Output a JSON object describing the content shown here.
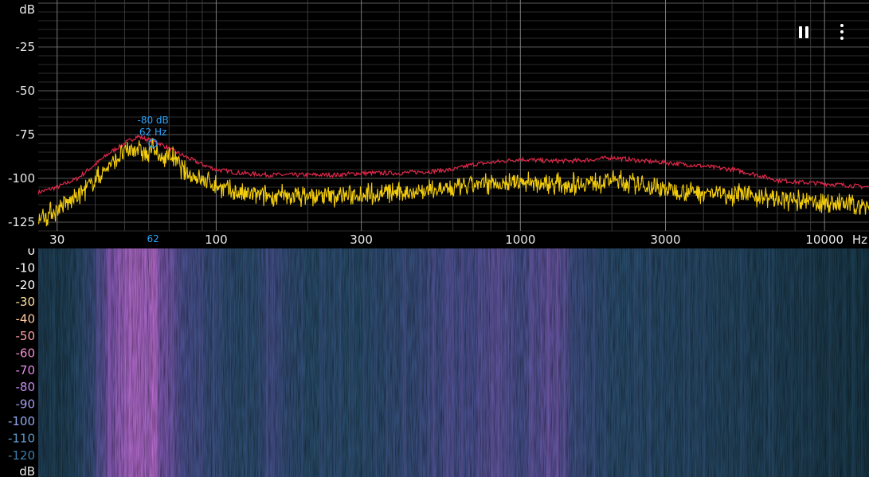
{
  "toolbar": {
    "pause_icon": "pause-icon",
    "menu_icon": "more-vert-icon"
  },
  "chart_data": [
    {
      "type": "line",
      "title": "",
      "xlabel": "Hz",
      "ylabel": "dB",
      "xscale": "log",
      "xlim": [
        26,
        14000
      ],
      "ylim": [
        -130,
        0
      ],
      "grid": true,
      "x_ticks": [
        30,
        100,
        300,
        1000,
        3000,
        10000
      ],
      "x_tick_labels": [
        "30",
        "100",
        "300",
        "1000",
        "3000",
        "10000"
      ],
      "y_ticks": [
        -25,
        -50,
        -75,
        -100,
        -125
      ],
      "y_tick_labels": [
        "-25",
        "-50",
        "-75",
        "-100",
        "-125"
      ],
      "series": [
        {
          "color": "#e0284a",
          "x": [
            26,
            30,
            35,
            40,
            45,
            50,
            55,
            60,
            65,
            70,
            80,
            90,
            100,
            120,
            150,
            200,
            250,
            300,
            400,
            500,
            600,
            700,
            800,
            1000,
            1200,
            1500,
            1800,
            2000,
            2500,
            3000,
            4000,
            5000,
            6000,
            7000,
            8000,
            10000,
            12000,
            14000
          ],
          "values": [
            -108,
            -105,
            -100,
            -92,
            -85,
            -80,
            -76,
            -78,
            -80,
            -83,
            -88,
            -92,
            -95,
            -97,
            -98,
            -98,
            -98,
            -97,
            -97,
            -96,
            -95,
            -92,
            -91,
            -89,
            -90,
            -90,
            -89,
            -88,
            -90,
            -91,
            -93,
            -95,
            -98,
            -101,
            -102,
            -103,
            -104,
            -105
          ]
        },
        {
          "color": "#f2cc0c",
          "x": [
            26,
            30,
            35,
            40,
            45,
            50,
            55,
            60,
            62,
            65,
            70,
            80,
            90,
            100,
            120,
            150,
            200,
            250,
            300,
            400,
            500,
            600,
            700,
            800,
            1000,
            1200,
            1500,
            1800,
            2000,
            2500,
            3000,
            4000,
            5000,
            6000,
            7000,
            8000,
            10000,
            12000,
            14000
          ],
          "values": [
            -123,
            -118,
            -110,
            -101,
            -92,
            -85,
            -82,
            -88,
            -80,
            -90,
            -86,
            -97,
            -101,
            -104,
            -109,
            -110,
            -110,
            -110,
            -109,
            -108,
            -107,
            -106,
            -104,
            -103,
            -102,
            -103,
            -103,
            -102,
            -101,
            -104,
            -106,
            -108,
            -109,
            -110,
            -112,
            -113,
            -114,
            -115,
            -116
          ]
        }
      ],
      "peak_marker": {
        "x": 62,
        "y": -80,
        "label_db": "-80 dB",
        "label_hz": "62 Hz",
        "axis_label": "62",
        "color": "#2aa6ff"
      }
    },
    {
      "type": "heatmap",
      "title": "",
      "ylabel": "dB",
      "xscale": "log",
      "xlim": [
        26,
        14000
      ],
      "colorbar_ticks": [
        "0",
        "-10",
        "-20",
        "-30",
        "-40",
        "-50",
        "-60",
        "-70",
        "-80",
        "-90",
        "-100",
        "-110",
        "-120"
      ],
      "colorbar_colors": [
        "#ffffff",
        "#ffffff",
        "#ffffff",
        "#ffe0a0",
        "#ffc9a0",
        "#ff9fa8",
        "#f38ed0",
        "#e18be8",
        "#c58ff0",
        "#a79cf2",
        "#8fa6ee",
        "#5f96c9",
        "#3c7fb0"
      ],
      "intensity_profile": {
        "x": [
          26,
          30,
          35,
          40,
          45,
          50,
          55,
          60,
          62,
          65,
          70,
          80,
          100,
          130,
          150,
          200,
          300,
          400,
          500,
          600,
          700,
          800,
          900,
          1000,
          1300,
          1500,
          2000,
          3000,
          5000,
          7000,
          10000,
          14000
        ],
        "level": [
          0.35,
          0.3,
          0.4,
          0.55,
          0.75,
          0.85,
          0.9,
          0.85,
          0.95,
          0.75,
          0.7,
          0.6,
          0.5,
          0.45,
          0.55,
          0.45,
          0.45,
          0.5,
          0.55,
          0.6,
          0.6,
          0.65,
          0.62,
          0.6,
          0.68,
          0.55,
          0.45,
          0.42,
          0.38,
          0.35,
          0.3,
          0.25
        ]
      }
    }
  ]
}
